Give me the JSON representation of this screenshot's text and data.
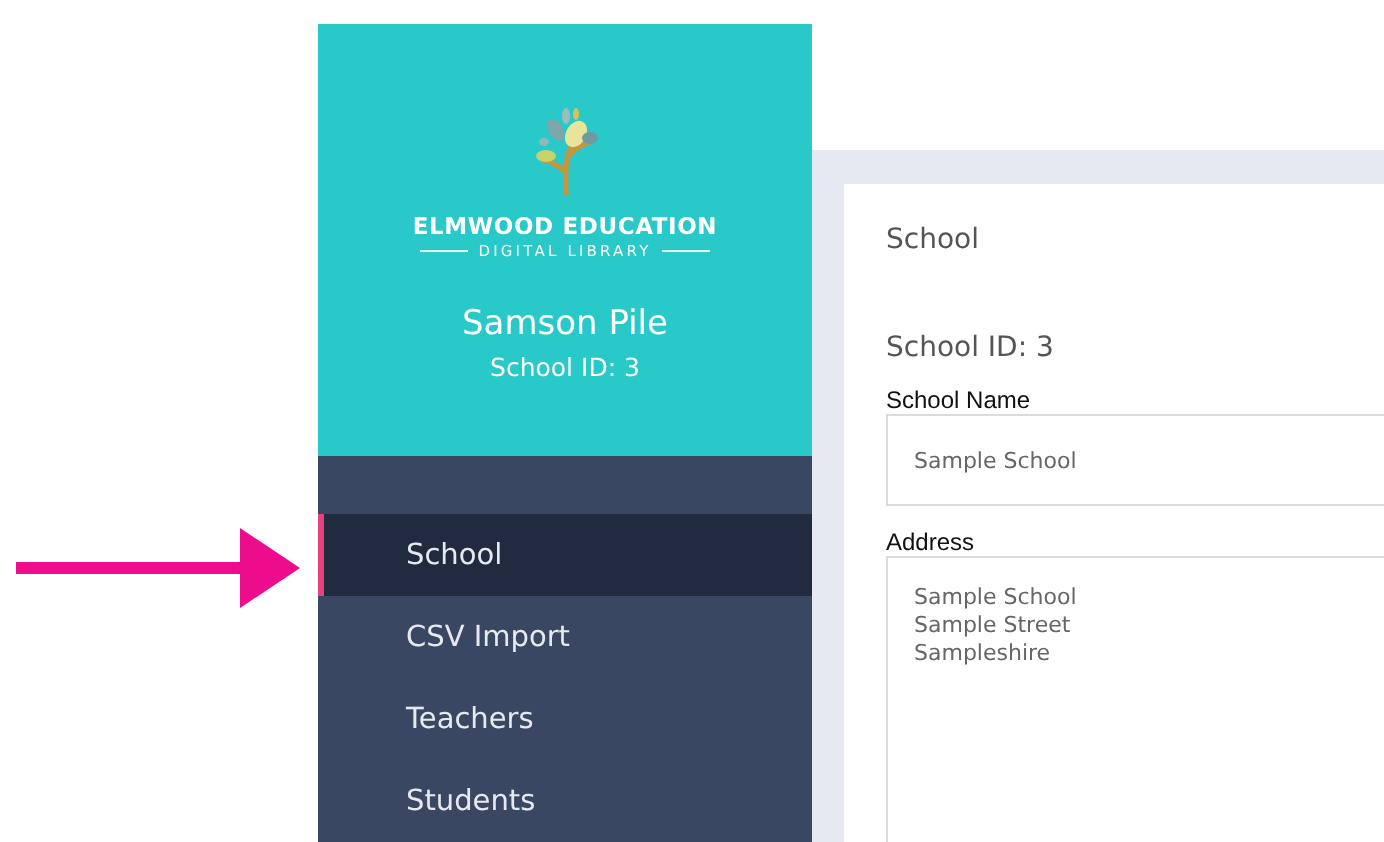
{
  "brand": {
    "name": "ELMWOOD EDUCATION",
    "tagline": "DIGITAL LIBRARY"
  },
  "user": {
    "name": "Samson Pile",
    "school_id": "School ID: 3"
  },
  "nav": [
    {
      "label": "School",
      "selected": true
    },
    {
      "label": "CSV Import",
      "selected": false
    },
    {
      "label": "Teachers",
      "selected": false
    },
    {
      "label": "Students",
      "selected": false
    }
  ],
  "card": {
    "title": "School",
    "school_id": "School ID: 3",
    "fields": [
      {
        "label": "School Name",
        "kind": "input",
        "value": "Sample School"
      },
      {
        "label": "Address",
        "kind": "textarea",
        "value": "Sample School\nSample Street\nSampleshire"
      }
    ]
  },
  "annotation": {
    "kind": "arrow"
  }
}
